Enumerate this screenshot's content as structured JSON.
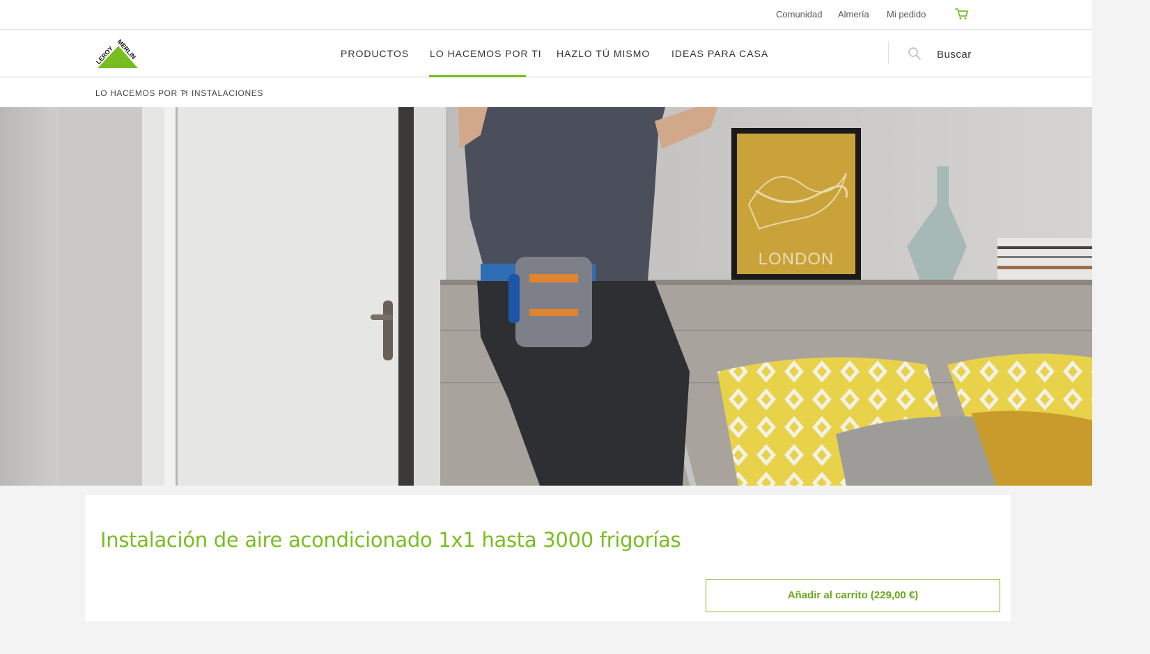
{
  "topbar": {
    "links": [
      "Comunidad",
      "Almería",
      "Mi pedido"
    ],
    "cart_icon": "shopping-cart-icon"
  },
  "header": {
    "logo_text": "LEROY MERLIN",
    "nav": [
      "PRODUCTOS",
      "LO HACEMOS POR TI",
      "HAZLO TÚ MISMO",
      "IDEAS PARA CASA"
    ],
    "active_nav": "LO HACEMOS POR TI",
    "search_icon": "search-icon",
    "search_label": "Buscar"
  },
  "breadcrumb": {
    "items": [
      "LO HACEMOS POR TI",
      "INSTALACIONES"
    ],
    "separator": ">"
  },
  "hero": {
    "poster_text": "LONDON"
  },
  "product": {
    "title": "Instalación de aire acondicionado 1x1 hasta 3000 frigorías",
    "add_to_cart_label": "Añadir al carrito (229,00 €)"
  },
  "colors": {
    "brand_green": "#78be20",
    "text": "#333333",
    "page_bg": "#f3f3f3"
  }
}
